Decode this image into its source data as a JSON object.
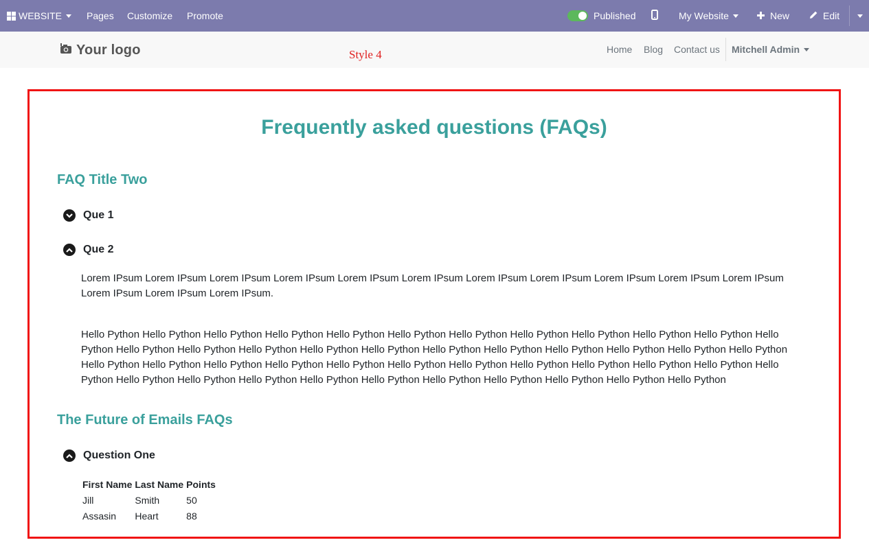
{
  "topbar": {
    "website_label": "WEBSITE",
    "pages": "Pages",
    "customize": "Customize",
    "promote": "Promote",
    "published": "Published",
    "published_state": true,
    "my_website": "My Website",
    "new": "New",
    "edit": "Edit"
  },
  "header": {
    "logo_text": "Your logo",
    "style_label": "Style 4",
    "nav": [
      "Home",
      "Blog",
      "Contact us"
    ],
    "user": "Mitchell Admin"
  },
  "faq": {
    "title": "Frequently asked questions (FAQs)",
    "sections": [
      {
        "title": "FAQ Title Two",
        "questions": [
          {
            "label": "Que 1",
            "expanded": false
          },
          {
            "label": "Que 2",
            "expanded": true,
            "answer_p1": "Lorem IPsum Lorem IPsum Lorem IPsum Lorem IPsum Lorem IPsum Lorem IPsum Lorem IPsum Lorem IPsum Lorem IPsum Lorem IPsum Lorem IPsum Lorem IPsum Lorem IPsum Lorem IPsum.",
            "answer_p2": "Hello Python Hello Python Hello Python Hello Python Hello Python Hello Python Hello Python Hello Python Hello Python Hello Python Hello Python Hello Python Hello Python Hello Python Hello Python Hello Python Hello Python Hello Python Hello Python Hello Python Hello Python Hello Python Hello Python Hello Python Hello Python Hello Python Hello Python Hello Python Hello Python Hello Python Hello Python Hello Python Hello Python Hello Python Hello Python Hello Python Hello Python Hello Python Hello Python Hello Python Hello Python Hello Python Hello Python Hello Python Hello Python"
          }
        ]
      },
      {
        "title": "The Future of Emails FAQs",
        "questions": [
          {
            "label": "Question One",
            "expanded": true,
            "table": {
              "headers": [
                "First Name",
                "Last Name",
                "Points"
              ],
              "rows": [
                [
                  "Jill",
                  "Smith",
                  "50"
                ],
                [
                  "Assasin",
                  "Heart",
                  "88"
                ]
              ]
            }
          }
        ]
      }
    ]
  },
  "colors": {
    "topbar_bg": "#7c7bad",
    "accent_teal": "#3aa09c",
    "highlight_border": "#f01414",
    "style_label": "#e02020",
    "published_toggle": "#5cb85c"
  }
}
